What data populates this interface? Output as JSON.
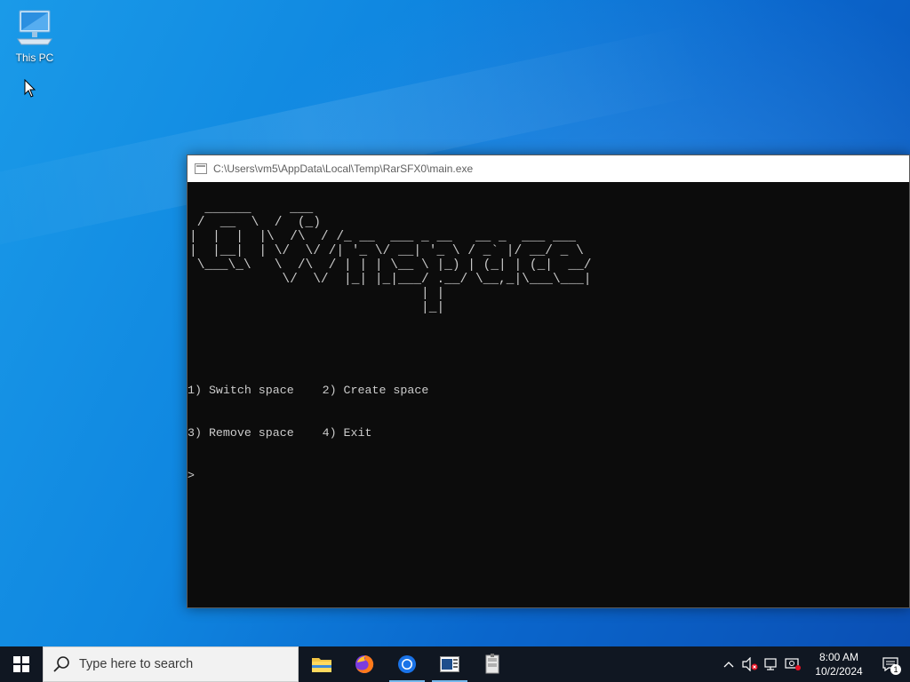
{
  "desktop": {
    "icons": [
      {
        "label": "This PC",
        "icon": "this-pc-icon"
      }
    ]
  },
  "console": {
    "title": "C:\\Users\\vm5\\AppData\\Local\\Temp\\RarSFX0\\main.exe",
    "banner": "  ______     ___        \n /  __  \\  /  (_)       \n|  |  |  |\\  /\\  / /_ __  ___ _ __   __ _  ___ ___ \n|  |__|  | \\/  \\/ /| '_ \\/ __| '_ \\ / _` |/ __/ _ \\\n \\___\\_\\   \\  /\\  / | | | \\__ \\ |_) | (_| | (_|  __/\n            \\/  \\/  |_| |_|___/ .__/ \\__,_|\\___\\___|\n                              | |                   \n                              |_|                   ",
    "menu": [
      "1) Switch space    2) Create space",
      "3) Remove space    4) Exit"
    ],
    "prompt": ">"
  },
  "taskbar": {
    "search_placeholder": "Type here to search",
    "apps": [
      {
        "name": "file-explorer",
        "icon": "folder-icon"
      },
      {
        "name": "firefox",
        "icon": "firefox-icon"
      },
      {
        "name": "chrome",
        "icon": "chrome-icon"
      },
      {
        "name": "console-window",
        "icon": "terminal-icon"
      },
      {
        "name": "archive-app",
        "icon": "archive-icon"
      }
    ],
    "time": "8:00 AM",
    "date": "10/2/2024",
    "notification_count": "1"
  }
}
